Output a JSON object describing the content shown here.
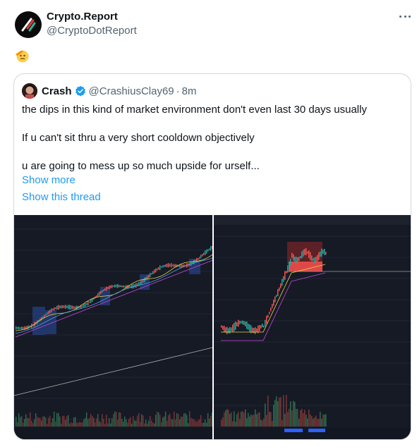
{
  "post": {
    "author": {
      "display_name": "Crypto.Report",
      "handle": "@CryptoDotReport"
    },
    "emoji": "saluting-face"
  },
  "quote": {
    "author": {
      "display_name": "Crash",
      "handle": "@CrashiusClay69",
      "separator": "·",
      "time": "8m",
      "verified": true
    },
    "lines": [
      "the dips in this kind of market environment don't even last 30 days usually",
      "If u can't sit thru a very short cooldown objectively",
      "u are going to mess up so much upside for urself..."
    ],
    "show_more": "Show more",
    "show_thread": "Show this thread"
  },
  "colors": {
    "link": "#1d9bf0",
    "muted": "#536471",
    "chart_bg": "#161a25",
    "verified": "#1d9bf0"
  }
}
